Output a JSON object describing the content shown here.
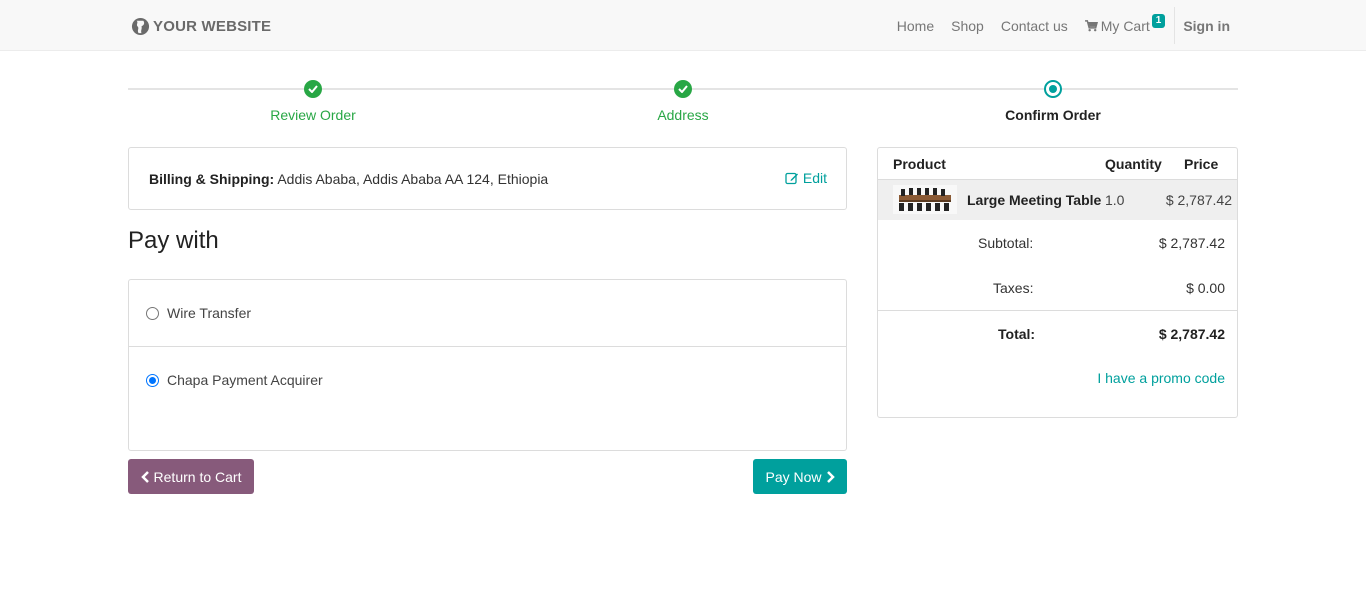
{
  "brand": {
    "name": "YOUR WEBSITE"
  },
  "nav": {
    "home": "Home",
    "shop": "Shop",
    "contact": "Contact us",
    "cart": "My Cart",
    "cart_count": "1",
    "signin": "Sign in"
  },
  "steps": [
    {
      "label": "Review Order",
      "state": "done"
    },
    {
      "label": "Address",
      "state": "done"
    },
    {
      "label": "Confirm Order",
      "state": "current"
    }
  ],
  "address": {
    "label": "Billing & Shipping:",
    "value": "Addis Ababa, Addis Ababa AA 124, Ethiopia",
    "edit": "Edit"
  },
  "payment": {
    "title": "Pay with",
    "methods": [
      {
        "label": "Wire Transfer",
        "selected": false
      },
      {
        "label": "Chapa Payment Acquirer",
        "selected": true
      }
    ]
  },
  "buttons": {
    "return": "Return to Cart",
    "pay": "Pay Now"
  },
  "summary": {
    "headers": {
      "product": "Product",
      "quantity": "Quantity",
      "price": "Price"
    },
    "item": {
      "name": "Large Meeting Table",
      "quantity": "1.0",
      "price": "$ 2,787.42"
    },
    "subtotal_label": "Subtotal:",
    "subtotal": "$ 2,787.42",
    "taxes_label": "Taxes:",
    "taxes": "$ 0.00",
    "total_label": "Total:",
    "total": "$ 2,787.42",
    "promo": "I have a promo code"
  },
  "colors": {
    "accent": "#00A09D",
    "primary": "#875A7B",
    "success": "#28a745",
    "radio": "#0075ff"
  }
}
